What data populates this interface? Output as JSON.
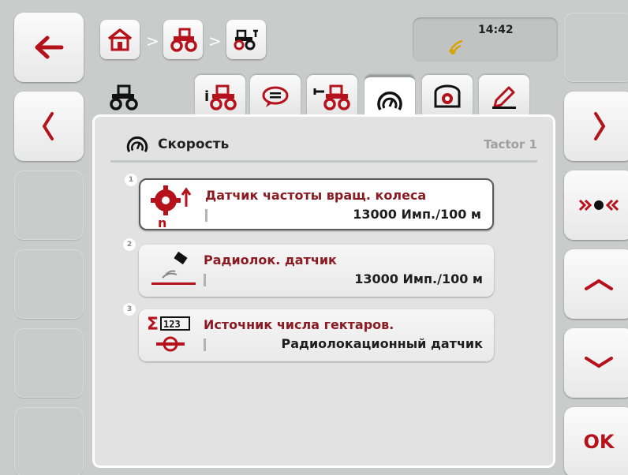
{
  "header": {
    "breadcrumb": [
      {
        "name": "home-crumb",
        "icon": "home-icon"
      },
      {
        "name": "tractor-crumb",
        "icon": "tractor-icon"
      },
      {
        "name": "tractor-settings-crumb",
        "icon": "tractor-settings-icon"
      }
    ],
    "separator": ">",
    "clock": "14:42",
    "gps_icon": "gps-signal-icon"
  },
  "tabs": [
    {
      "name": "tab-tractor",
      "icon": "tractor-icon"
    },
    {
      "name": "tab-info",
      "icon": "tractor-info-icon"
    },
    {
      "name": "tab-messages",
      "icon": "speech-bubble-icon"
    },
    {
      "name": "tab-hitch",
      "icon": "tractor-hitch-icon"
    },
    {
      "name": "tab-speed",
      "icon": "speedometer-icon",
      "active": true
    },
    {
      "name": "tab-pto",
      "icon": "pto-icon"
    },
    {
      "name": "tab-edit",
      "icon": "pencil-icon"
    }
  ],
  "panel": {
    "title": "Скорость",
    "subtitle": "Tactor 1",
    "items": [
      {
        "num": "1",
        "label": "Датчик частоты вращ. колеса",
        "value": "13000 Имп./100 м",
        "icon": "wheel-sensor-icon"
      },
      {
        "num": "2",
        "label": "Радиолок. датчик",
        "value": "13000 Имп./100 м",
        "icon": "radar-sensor-icon"
      },
      {
        "num": "3",
        "label": "Источник числа гектаров.",
        "value": "Радиолокационный датчик",
        "icon": "hectare-counter-source-icon"
      }
    ]
  },
  "right_buttons": {
    "ok_label": "OK"
  },
  "colors": {
    "accent_red": "#b5121b",
    "label_red": "#8a1b22",
    "background": "#c9cccb"
  }
}
